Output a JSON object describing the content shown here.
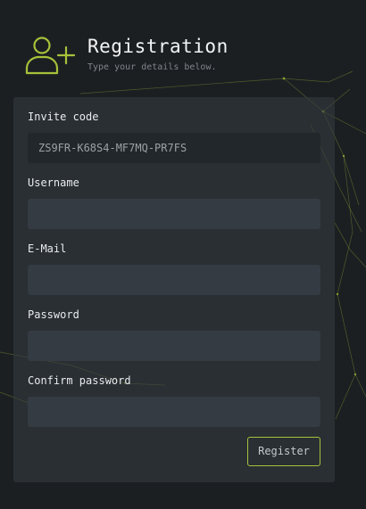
{
  "header": {
    "title": "Registration",
    "subtitle": "Type your details below.",
    "icon": "user-plus-icon",
    "accent_color": "#a7c23a"
  },
  "form": {
    "invite_code": {
      "label": "Invite code",
      "value": "ZS9FR-K68S4-MF7MQ-PR7FS"
    },
    "username": {
      "label": "Username",
      "value": ""
    },
    "email": {
      "label": "E-Mail",
      "value": ""
    },
    "password": {
      "label": "Password",
      "value": ""
    },
    "confirm_password": {
      "label": "Confirm password",
      "value": ""
    },
    "register_label": "Register"
  }
}
